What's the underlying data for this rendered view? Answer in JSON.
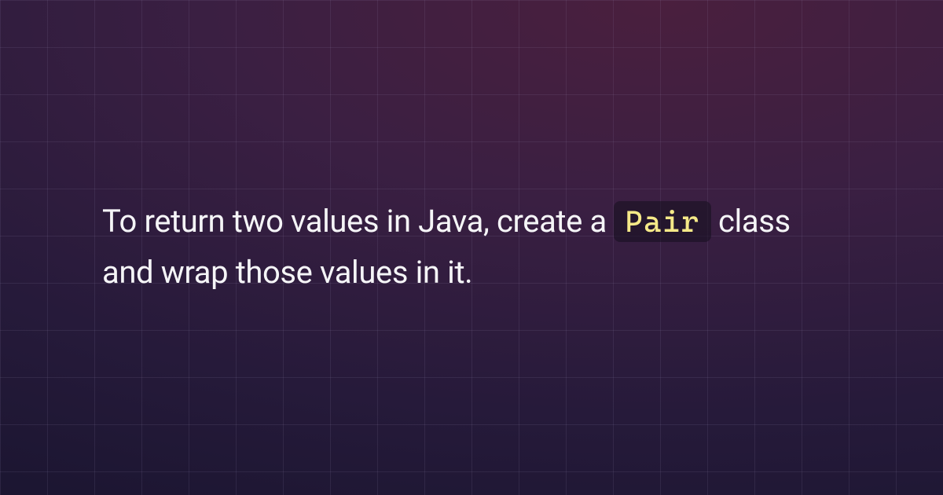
{
  "content": {
    "text_before_code": "To return two values in Java, create a ",
    "code_text": "Pair",
    "text_after_code": " class and wrap those values in it."
  },
  "colors": {
    "code_color": "#f5e988",
    "text_color": "#f5f5f7"
  }
}
